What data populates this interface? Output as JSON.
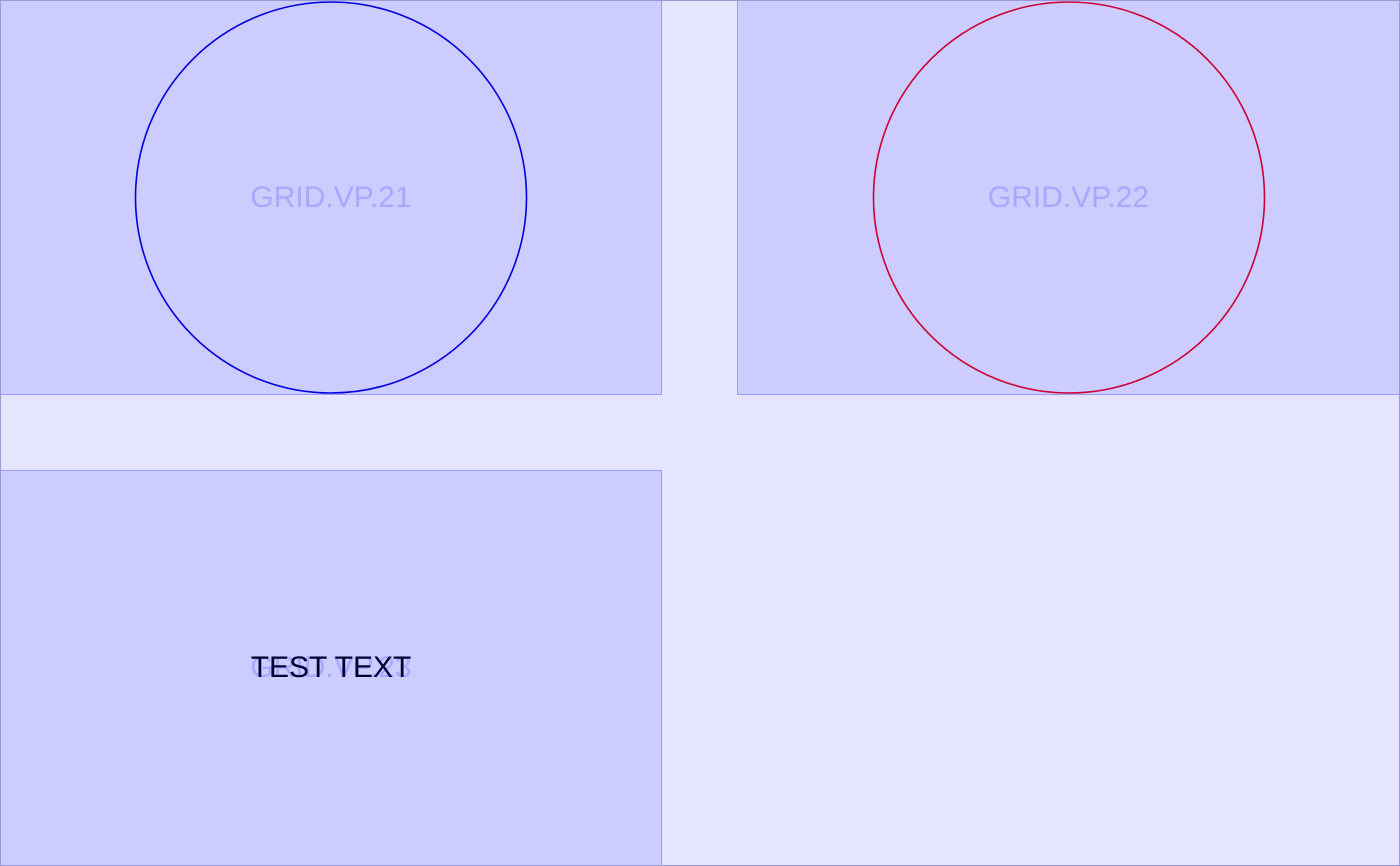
{
  "viewports": {
    "vp21": {
      "label": "GRID.VP.21",
      "circle_color": "#0000dd"
    },
    "vp22": {
      "label": "GRID.VP.22",
      "circle_color": "#cc0033"
    },
    "vp23": {
      "label": "GRID.VP.23",
      "overlay_text": "TEST TEXT"
    }
  },
  "colors": {
    "background": "#e5e5ff",
    "viewport_fill": "#ccccff",
    "viewport_border": "#9a9aff",
    "label_color": "#a8a8ff",
    "text_color": "#000033"
  }
}
